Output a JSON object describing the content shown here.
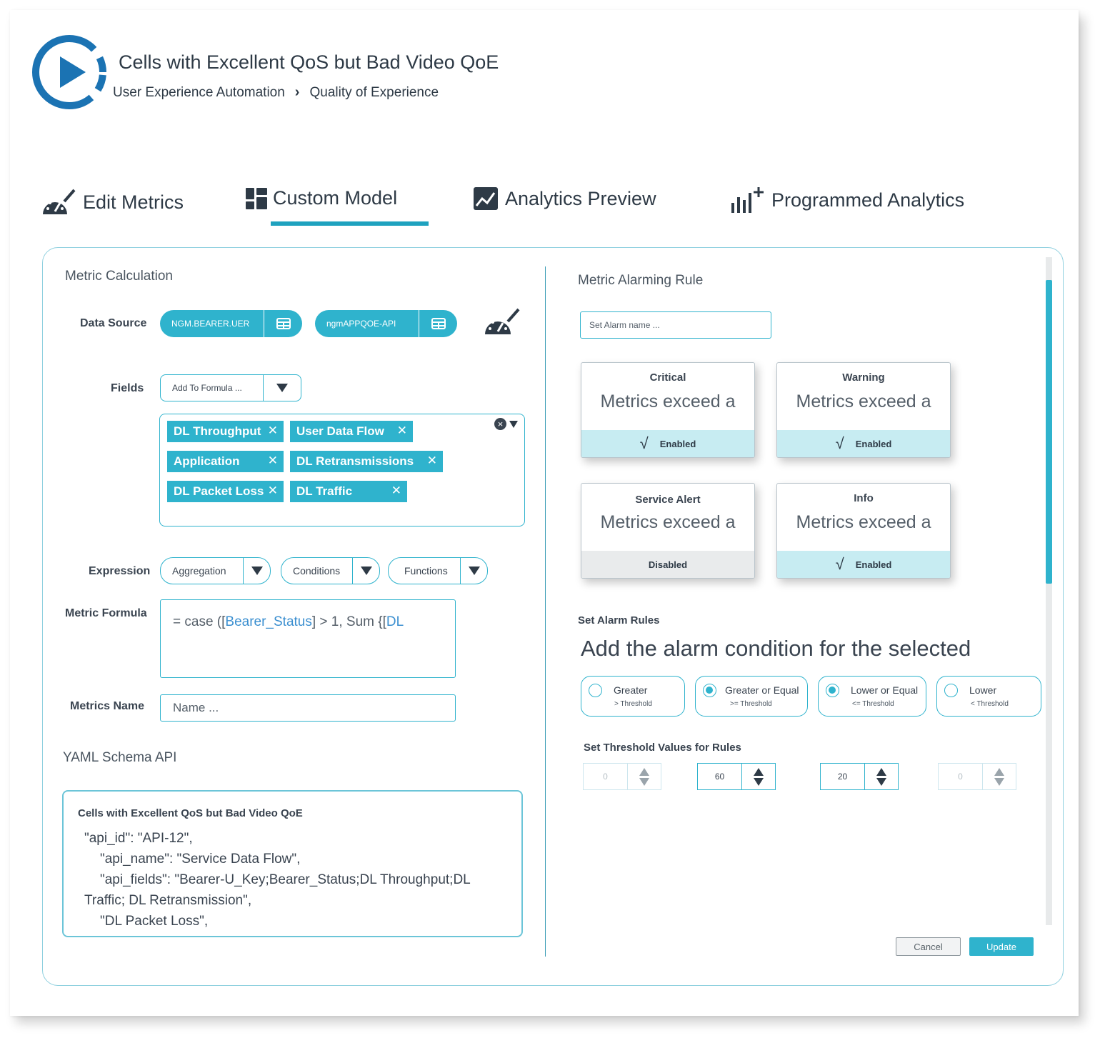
{
  "header": {
    "title": "Cells with Excellent QoS but Bad Video QoE",
    "breadcrumb": [
      "User Experience Automation",
      "Quality of Experience"
    ],
    "breadcrumb_sep": "›"
  },
  "tabs": [
    {
      "label": "Edit Metrics",
      "icon": "gauge-edit-icon"
    },
    {
      "label": "Custom Model",
      "icon": "dashboard-blocks-icon",
      "active": true
    },
    {
      "label": "Analytics Preview",
      "icon": "line-chart-icon"
    },
    {
      "label": "Programmed Analytics",
      "icon": "bar-chart-plus-icon"
    }
  ],
  "metric_calc": {
    "title": "Metric Calculation",
    "data_source_label": "Data Source",
    "data_sources": [
      "NGM.BEARER.UER",
      "ngmAPPQOE-API"
    ],
    "fields_label": "Fields",
    "fields_placeholder": "Add To Formula ...",
    "tags": [
      "DL Throughput",
      "User Data Flow",
      "Application",
      "DL Retransmissions",
      "DL Packet Loss",
      "DL Traffic"
    ],
    "tag_close": "✕",
    "expression_label": "Expression",
    "expression_selects": [
      "Aggregation",
      "Conditions",
      "Functions"
    ],
    "formula_label": "Metric Formula",
    "formula": {
      "prefix": "= case ([",
      "field1": "Bearer_Status",
      "mid": "] > 1, Sum {[",
      "field2": "DL"
    },
    "name_label": "Metrics Name",
    "name_placeholder": "Name ..."
  },
  "yaml": {
    "title": "YAML Schema API",
    "box_title": "Cells with Excellent QoS but Bad Video QoE",
    "lines": [
      "\"api_id\": \"API-12\",",
      "\"api_name\": \"Service Data Flow\",",
      "\"api_fields\": \"Bearer-U_Key;Bearer_Status;DL Throughput;DL",
      "Traffic; DL Retransmission\",",
      "\"DL Packet Loss\","
    ]
  },
  "alarm": {
    "title": "Metric Alarming Rule",
    "name_placeholder": "Set  Alarm name ...",
    "cards": [
      {
        "title": "Critical",
        "desc": "Metrics exceed a",
        "status": "Enabled",
        "enabled": true
      },
      {
        "title": "Warning",
        "desc": "Metrics exceed a",
        "status": "Enabled",
        "enabled": true
      },
      {
        "title": "Service Alert",
        "desc": "Metrics exceed a",
        "status": "Disabled",
        "enabled": false
      },
      {
        "title": "Info",
        "desc": "Metrics exceed a",
        "status": "Enabled",
        "enabled": true
      }
    ],
    "check_glyph": "√",
    "rules_label": "Set Alarm Rules",
    "rules_text": "Add the alarm condition for the selected",
    "rules": [
      {
        "name": "Greater",
        "sub": "> Threshold",
        "selected": false
      },
      {
        "name": "Greater or Equal",
        "sub": ">= Threshold",
        "selected": true
      },
      {
        "name": "Lower or Equal",
        "sub": "<= Threshold",
        "selected": true
      },
      {
        "name": "Lower",
        "sub": "< Threshold",
        "selected": false
      }
    ],
    "threshold_label": "Set Threshold Values for Rules",
    "thresholds": [
      "0",
      "60",
      "20",
      "0"
    ],
    "cancel": "Cancel",
    "update": "Update"
  },
  "colors": {
    "accent": "#2fb3cd",
    "text": "#2e3a46",
    "enabled_bg": "#c7ecf2"
  }
}
